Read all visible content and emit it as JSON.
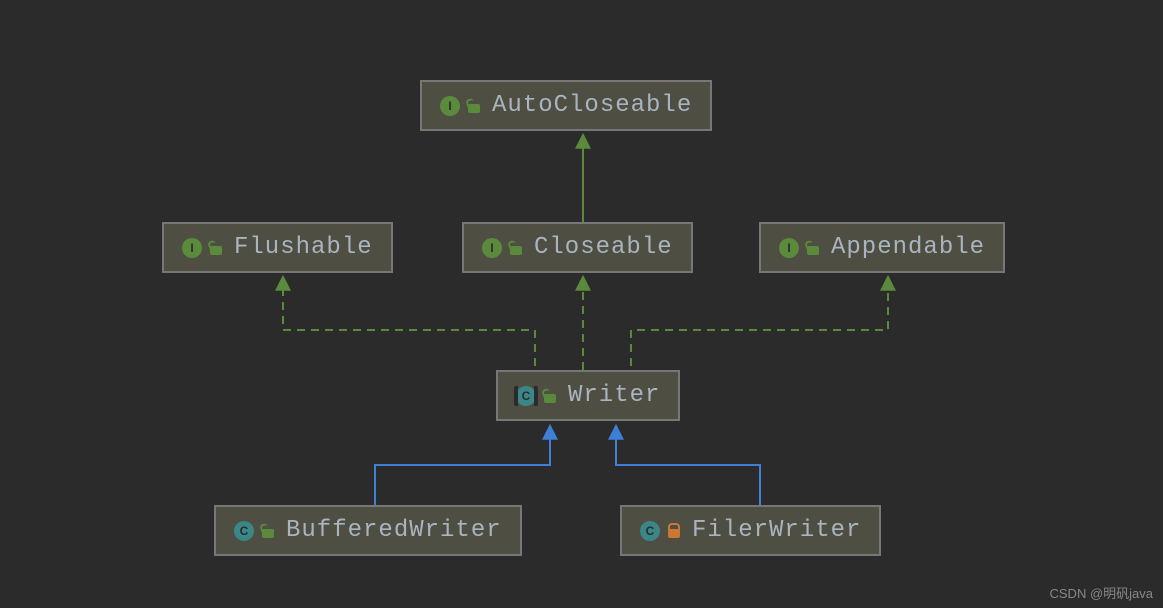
{
  "nodes": {
    "autocloseable": {
      "label": "AutoCloseable",
      "kind": "I",
      "lock": "open"
    },
    "flushable": {
      "label": "Flushable",
      "kind": "I",
      "lock": "open"
    },
    "closeable": {
      "label": "Closeable",
      "kind": "I",
      "lock": "open"
    },
    "appendable": {
      "label": "Appendable",
      "kind": "I",
      "lock": "open"
    },
    "writer": {
      "label": "Writer",
      "kind": "AC",
      "lock": "open"
    },
    "bufferedwriter": {
      "label": "BufferedWriter",
      "kind": "C",
      "lock": "open"
    },
    "filerwriter": {
      "label": "FilerWriter",
      "kind": "C",
      "lock": "closed"
    }
  },
  "edges": [
    {
      "from": "closeable",
      "to": "autocloseable",
      "style": "solid",
      "color": "green"
    },
    {
      "from": "writer",
      "to": "flushable",
      "style": "dashed",
      "color": "green"
    },
    {
      "from": "writer",
      "to": "closeable",
      "style": "dashed",
      "color": "green"
    },
    {
      "from": "writer",
      "to": "appendable",
      "style": "dashed",
      "color": "green"
    },
    {
      "from": "bufferedwriter",
      "to": "writer",
      "style": "solid",
      "color": "blue"
    },
    {
      "from": "filerwriter",
      "to": "writer",
      "style": "solid",
      "color": "blue"
    }
  ],
  "colors": {
    "green": "#5b8a3d",
    "blue": "#3f7fd6"
  },
  "watermark": "CSDN @明矾java"
}
